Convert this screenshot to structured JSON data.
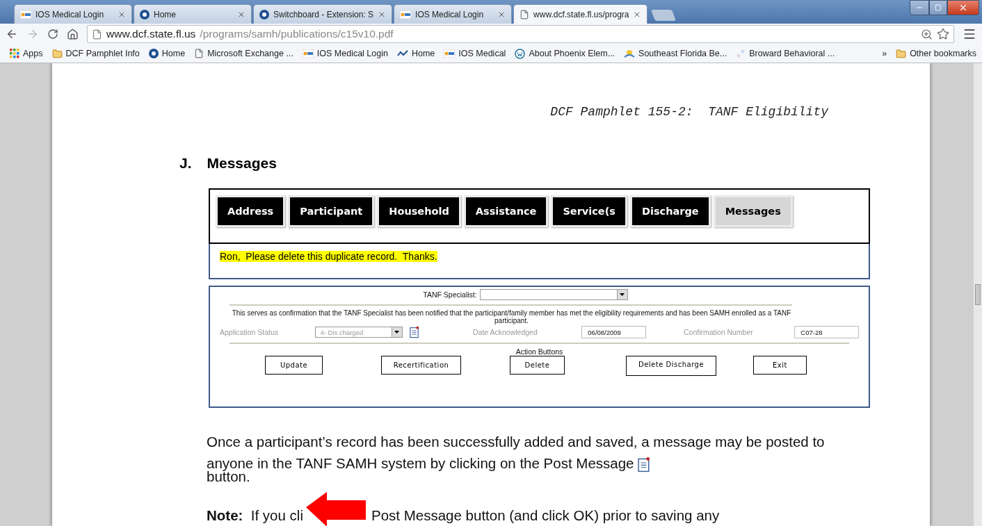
{
  "browser_tabs": [
    {
      "title": "IOS Medical Login",
      "kind": "ios",
      "selected": false
    },
    {
      "title": "Home",
      "kind": "s",
      "selected": false
    },
    {
      "title": "Switchboard - Extension: S",
      "kind": "s",
      "selected": false
    },
    {
      "title": "IOS Medical Login",
      "kind": "ios",
      "selected": false
    },
    {
      "title": "www.dcf.state.fl.us/progra",
      "kind": "page",
      "selected": true
    }
  ],
  "address_bar": {
    "host": "www.dcf.state.fl.us",
    "path": "/programs/samh/publications/c15v10.pdf"
  },
  "bookmarks": [
    {
      "label": "Apps",
      "kind": "apps"
    },
    {
      "label": "DCF Pamphlet Info",
      "kind": "folder"
    },
    {
      "label": "Home",
      "kind": "s"
    },
    {
      "label": "Microsoft Exchange ...",
      "kind": "page"
    },
    {
      "label": "IOS Medical Login",
      "kind": "ios"
    },
    {
      "label": "Home",
      "kind": "wave"
    },
    {
      "label": "IOS Medical",
      "kind": "ios"
    },
    {
      "label": "About Phoenix Elem...",
      "kind": "wp"
    },
    {
      "label": "Southeast Florida Be...",
      "kind": "sun"
    },
    {
      "label": "Broward Behavioral ...",
      "kind": "blank"
    }
  ],
  "bookmarks_overflow": "»",
  "other_bookmarks": "Other bookmarks",
  "document": {
    "header": "DCF Pamphlet 155-2:  TANF Eligibility",
    "section_letter": "J.",
    "section_title": "Messages",
    "form_tabs": [
      {
        "label": "Address",
        "selected": false
      },
      {
        "label": "Participant",
        "selected": false
      },
      {
        "label": "Household",
        "selected": false
      },
      {
        "label": "Assistance",
        "selected": false
      },
      {
        "label": "Service(s",
        "selected": false
      },
      {
        "label": "Discharge",
        "selected": false
      },
      {
        "label": "Messages",
        "selected": true
      }
    ],
    "message": "Ron,  Please delete this duplicate record.  Thanks.",
    "tanf_specialist_label": "TANF Specialist:",
    "confirmation_text": "This serves as confirmation that the TANF Specialist has been notified that the participant/family member has met the eligibility requirements and has been SAMH enrolled as a TANF participant.",
    "application_status_label": "Application Status",
    "application_status": "4- Dis charged",
    "date_label": "Date Acknowledged",
    "date": "06/08/2009",
    "confirmation_label": "Confirmation Number",
    "confirmation_number": "C07-28",
    "action_buttons_label": "Action Buttons",
    "action_buttons": [
      "Update",
      "Recertification",
      "Delete",
      "Delete Discharge",
      "Exit"
    ],
    "paragraph": "Once a participant’s record has been successfully added and saved, a message may be posted to anyone in the TANF SAMH system by clicking on the Post Message",
    "paragraph_end": "button.",
    "note_start": "**Note:**  If you cli",
    "note_end": "Post Message button (and click OK) prior to saving any"
  }
}
